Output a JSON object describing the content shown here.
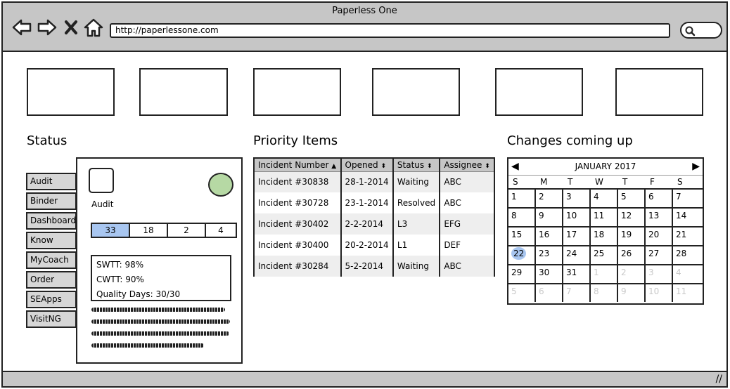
{
  "window": {
    "title": "Paperless One",
    "url": "http://paperlessone.com"
  },
  "status": {
    "heading": "Status",
    "tabs": [
      "Audit",
      "Binder",
      "Dashboard",
      "Know",
      "MyCoach",
      "Order",
      "SEApps",
      "VisitNG"
    ],
    "card_label": "Audit",
    "counters": [
      "33",
      "18",
      "2",
      "4"
    ],
    "active_counter": 0,
    "metrics": [
      "SWTT: 98%",
      "CWTT: 90%",
      "Quality Days: 30/30"
    ]
  },
  "priority": {
    "heading": "Priority Items",
    "columns": [
      "Incident Number",
      "Opened",
      "Status",
      "Assignee"
    ],
    "rows": [
      [
        "Incident #30838",
        "28-1-2014",
        "Waiting",
        "ABC"
      ],
      [
        "Incident #30728",
        "23-1-2014",
        "Resolved",
        "ABC"
      ],
      [
        "Incident #30402",
        "2-2-2014",
        "L3",
        "EFG"
      ],
      [
        "Incident #30400",
        "20-2-2014",
        "L1",
        "DEF"
      ],
      [
        "Incident #30284",
        "5-2-2014",
        "Waiting",
        "ABC"
      ]
    ]
  },
  "changes": {
    "heading": "Changes coming up",
    "month": "JANUARY 2017",
    "days_of_week": [
      "S",
      "M",
      "T",
      "W",
      "T",
      "F",
      "S"
    ],
    "weeks": [
      [
        "1",
        "2",
        "3",
        "4",
        "5",
        "6",
        "7"
      ],
      [
        "8",
        "9",
        "10",
        "11",
        "12",
        "13",
        "14"
      ],
      [
        "15",
        "16",
        "17",
        "18",
        "19",
        "20",
        "21"
      ],
      [
        "22",
        "23",
        "24",
        "25",
        "26",
        "27",
        "28"
      ],
      [
        "29",
        "30",
        "31",
        "1",
        "2",
        "3",
        "4"
      ],
      [
        "5",
        "6",
        "7",
        "8",
        "9",
        "10",
        "11"
      ]
    ],
    "selected_day": "22"
  },
  "colors": {
    "chrome": "#c6c6c6",
    "accent": "#a8c6f0",
    "status_dot": "#b6d9a4"
  }
}
